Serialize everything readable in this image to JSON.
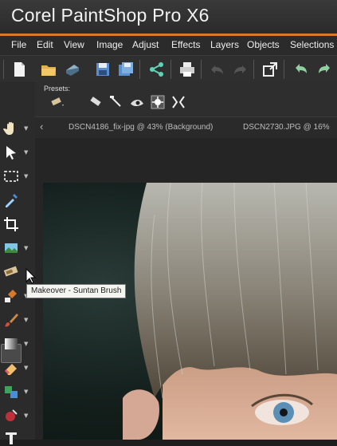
{
  "app": {
    "title": "Corel PaintShop Pro X6"
  },
  "menu": [
    "File",
    "Edit",
    "View",
    "Image",
    "Adjust",
    "Effects",
    "Layers",
    "Objects",
    "Selections"
  ],
  "toolbar": {
    "icons": [
      "new-file-icon",
      "open-folder-icon",
      "scan-icon",
      "save-icon",
      "save-as-icon",
      "share-icon",
      "print-icon",
      "undo-icon",
      "redo-icon",
      "fullscreen-icon",
      "rotate-left-icon",
      "rotate-right-icon"
    ]
  },
  "tool_options": {
    "presets_label": "Presets:"
  },
  "tabs": [
    {
      "label": "DSCN4186_fix-jpg @  43% (Background)"
    },
    {
      "label": "DSCN2730.JPG @  16%"
    }
  ],
  "tools": [
    "pan-tool-icon",
    "pick-tool-icon",
    "selection-tool-icon",
    "dropper-tool-icon",
    "crop-tool-icon",
    "straighten-tool-icon",
    "makeover-tool-icon",
    "clone-brush-icon",
    "paint-brush-icon",
    "gradient-icon",
    "eraser-icon",
    "fill-icon",
    "object-remover-icon",
    "text-tool-icon"
  ],
  "tooltip": {
    "text": "Makeover - Suntan Brush"
  }
}
